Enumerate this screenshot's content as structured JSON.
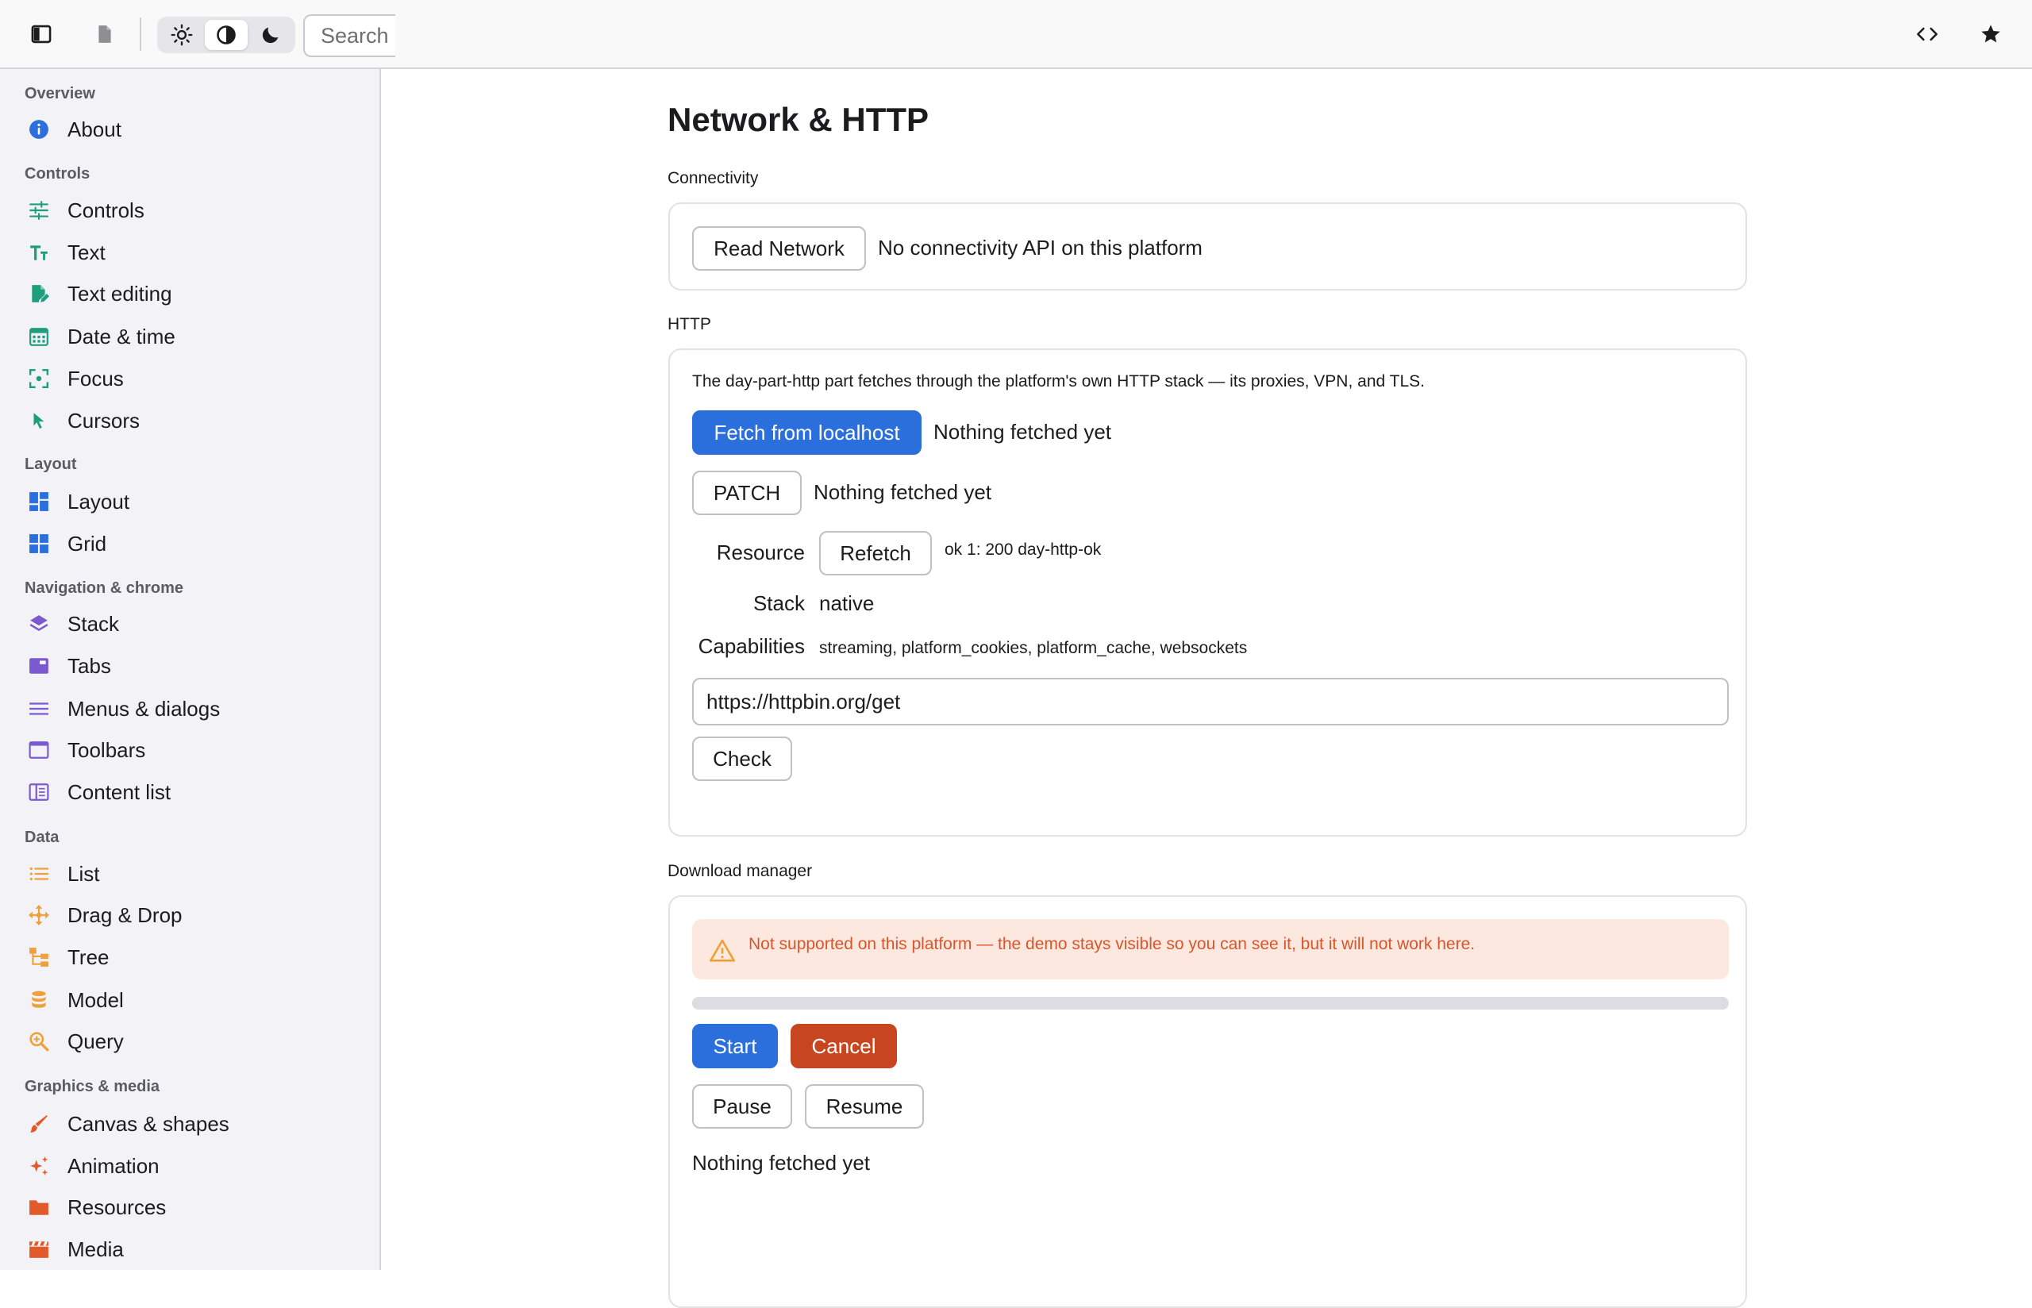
{
  "toolbar": {
    "search_placeholder": "Search",
    "icons": [
      "sidebar-toggle-icon",
      "document-icon",
      "sun-icon",
      "contrast-icon",
      "moon-icon",
      "code-icon",
      "star-icon"
    ],
    "theme_active": "auto"
  },
  "sidebar": {
    "sections": [
      {
        "title": "Overview",
        "items": [
          {
            "label": "About",
            "icon": "info-icon"
          }
        ]
      },
      {
        "title": "Controls",
        "items": [
          {
            "label": "Controls",
            "icon": "sliders-icon"
          },
          {
            "label": "Text",
            "icon": "text-size-icon"
          },
          {
            "label": "Text editing",
            "icon": "edit-document-icon"
          },
          {
            "label": "Date & time",
            "icon": "calendar-icon"
          },
          {
            "label": "Focus",
            "icon": "focus-icon"
          },
          {
            "label": "Cursors",
            "icon": "cursor-icon"
          }
        ]
      },
      {
        "title": "Layout",
        "items": [
          {
            "label": "Layout",
            "icon": "layout-icon"
          },
          {
            "label": "Grid",
            "icon": "grid-icon"
          }
        ]
      },
      {
        "title": "Navigation & chrome",
        "items": [
          {
            "label": "Stack",
            "icon": "layers-icon"
          },
          {
            "label": "Tabs",
            "icon": "tabs-icon"
          },
          {
            "label": "Menus & dialogs",
            "icon": "menu-icon"
          },
          {
            "label": "Toolbars",
            "icon": "window-icon"
          },
          {
            "label": "Content list",
            "icon": "content-list-icon"
          }
        ]
      },
      {
        "title": "Data",
        "items": [
          {
            "label": "List",
            "icon": "list-icon"
          },
          {
            "label": "Drag & Drop",
            "icon": "move-icon"
          },
          {
            "label": "Tree",
            "icon": "tree-icon"
          },
          {
            "label": "Model",
            "icon": "database-icon"
          },
          {
            "label": "Query",
            "icon": "zoom-icon"
          }
        ]
      },
      {
        "title": "Graphics & media",
        "items": [
          {
            "label": "Canvas & shapes",
            "icon": "brush-icon"
          },
          {
            "label": "Animation",
            "icon": "sparkle-icon"
          },
          {
            "label": "Resources",
            "icon": "folder-icon"
          },
          {
            "label": "Media",
            "icon": "clapper-icon"
          }
        ]
      }
    ]
  },
  "main": {
    "title": "Network & HTTP",
    "connectivity": {
      "label": "Connectivity",
      "button": "Read Network",
      "status": "No connectivity API on this platform"
    },
    "http": {
      "label": "HTTP",
      "description": "The day-part-http part fetches through the platform's own HTTP stack — its proxies, VPN, and TLS.",
      "fetch_button": "Fetch from localhost",
      "fetch_status": "Nothing fetched yet",
      "patch_button": "PATCH",
      "patch_status": "Nothing fetched yet",
      "resource_label": "Resource",
      "refetch_button": "Refetch",
      "resource_status": "ok 1: 200 day-http-ok",
      "stack_label": "Stack",
      "stack_value": "native",
      "capabilities_label": "Capabilities",
      "capabilities_value": "streaming, platform_cookies, platform_cache, websockets",
      "url_value": "https://httpbin.org/get",
      "check_button": "Check"
    },
    "download": {
      "label": "Download manager",
      "warning": "Not supported on this platform — the demo stays visible so you can see it, but it will not work here.",
      "progress": 0,
      "start_button": "Start",
      "cancel_button": "Cancel",
      "pause_button": "Pause",
      "resume_button": "Resume",
      "status": "Nothing fetched yet"
    }
  },
  "colors": {
    "accent": "#2a6fdb",
    "danger": "#c8461f",
    "warning_text": "#d9552a",
    "warning_bg": "#fde8e0",
    "green_icons": "#1f9e7e",
    "blue_icons": "#2a6fdb",
    "purple_icons": "#7b59d1",
    "orange_icons": "#eea13a",
    "red_icons": "#e35a2a"
  }
}
